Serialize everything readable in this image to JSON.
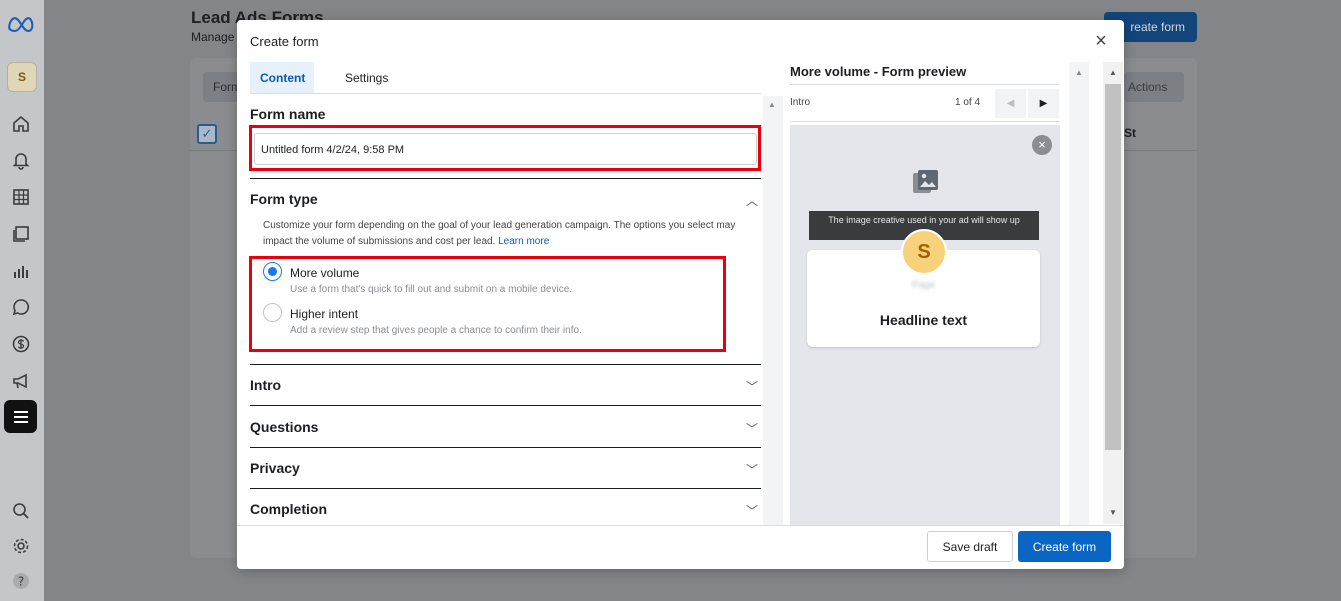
{
  "background": {
    "title": "Lead Ads Forms",
    "subtitle": "Manage f",
    "create_button": "reate form",
    "tab": "Form",
    "actions": "Actions",
    "column_st": "St"
  },
  "modal": {
    "title": "Create form",
    "tabs": [
      {
        "label": "Content"
      },
      {
        "label": "Settings"
      }
    ],
    "form_name": {
      "heading": "Form name",
      "value": "Untitled form 4/2/24, 9:58 PM"
    },
    "form_type": {
      "heading": "Form type",
      "description": "Customize your form depending on the goal of your lead generation campaign. The options you select may impact the volume of submissions and cost per lead.",
      "learn_more": "Learn more",
      "options": [
        {
          "label": "More volume",
          "description": "Use a form that's quick to fill out and submit on a mobile device.",
          "selected": true
        },
        {
          "label": "Higher intent",
          "description": "Add a review step that gives people a chance to confirm their info.",
          "selected": false
        }
      ]
    },
    "sections": [
      {
        "label": "Intro"
      },
      {
        "label": "Questions"
      },
      {
        "label": "Privacy"
      },
      {
        "label": "Completion"
      }
    ],
    "preview": {
      "title": "More volume - Form preview",
      "step": "Intro",
      "count": "1 of 4",
      "banner": "The image creative used in your ad will show up",
      "avatar_letter": "S",
      "page_name": "Page",
      "headline": "Headline text"
    },
    "footer": {
      "save_draft": "Save draft",
      "create_form": "Create form"
    }
  },
  "colors": {
    "primary": "#0a66c2",
    "highlight": "#e8000f",
    "radio": "#1877f2"
  }
}
